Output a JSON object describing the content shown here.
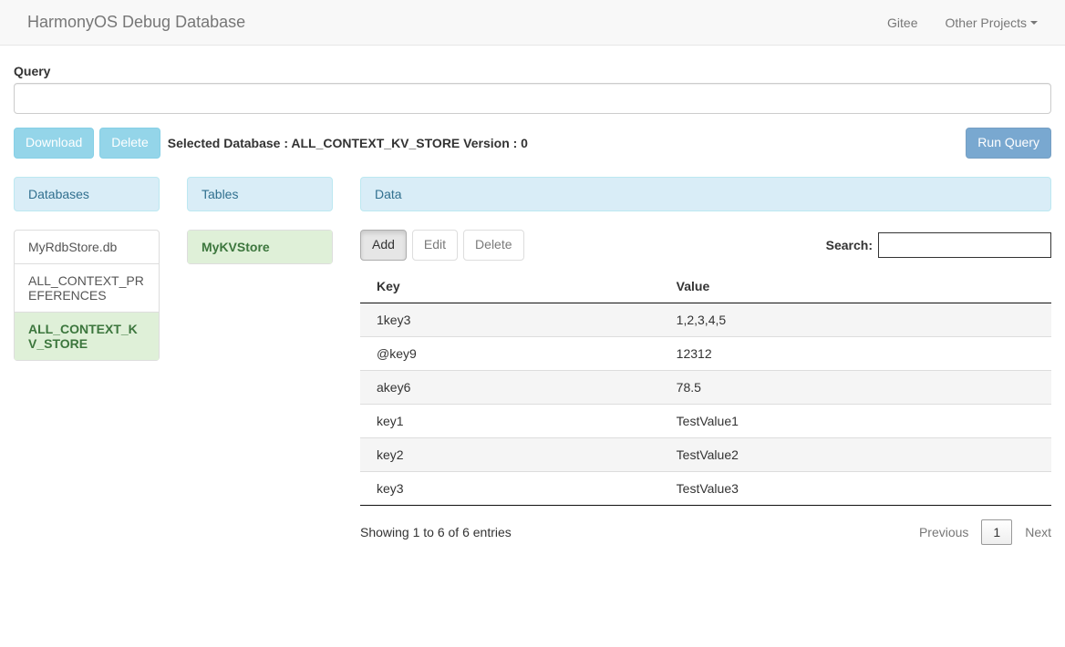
{
  "navbar": {
    "brand": "HarmonyOS Debug Database",
    "links": [
      {
        "label": "Gitee",
        "dropdown": false
      },
      {
        "label": "Other Projects",
        "dropdown": true
      }
    ]
  },
  "query": {
    "label": "Query",
    "value": ""
  },
  "actions": {
    "download": "Download",
    "delete": "Delete",
    "selected_text": "Selected Database : ALL_CONTEXT_KV_STORE Version : 0",
    "run_query": "Run Query"
  },
  "sections": {
    "databases": "Databases",
    "tables": "Tables",
    "data": "Data"
  },
  "databases": [
    {
      "name": "MyRdbStore.db",
      "active": false
    },
    {
      "name": "ALL_CONTEXT_PREFERENCES",
      "active": false
    },
    {
      "name": "ALL_CONTEXT_KV_STORE",
      "active": true
    }
  ],
  "tables": [
    {
      "name": "MyKVStore",
      "active": true
    }
  ],
  "data_toolbar": {
    "add": "Add",
    "edit": "Edit",
    "delete": "Delete",
    "search_label": "Search:"
  },
  "table": {
    "columns": [
      "Key",
      "Value"
    ],
    "rows": [
      {
        "key": "1key3",
        "value": "1,2,3,4,5"
      },
      {
        "key": "@key9",
        "value": "12312"
      },
      {
        "key": "akey6",
        "value": "78.5"
      },
      {
        "key": "key1",
        "value": "TestValue1"
      },
      {
        "key": "key2",
        "value": "TestValue2"
      },
      {
        "key": "key3",
        "value": "TestValue3"
      }
    ]
  },
  "footer": {
    "info": "Showing 1 to 6 of 6 entries",
    "previous": "Previous",
    "current_page": "1",
    "next": "Next"
  }
}
